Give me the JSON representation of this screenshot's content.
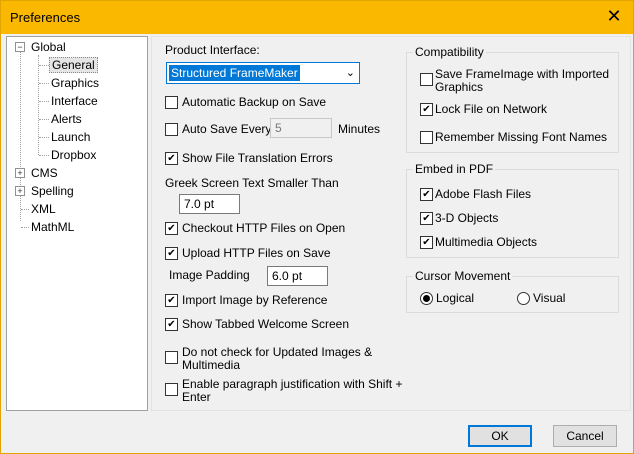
{
  "window": {
    "title": "Preferences",
    "close_glyph": "✕"
  },
  "tree": {
    "items": [
      {
        "label": "Global",
        "expander": "−"
      },
      {
        "label": "General"
      },
      {
        "label": "Graphics"
      },
      {
        "label": "Interface"
      },
      {
        "label": "Alerts"
      },
      {
        "label": "Launch"
      },
      {
        "label": "Dropbox"
      },
      {
        "label": "CMS",
        "expander": "+"
      },
      {
        "label": "Spelling",
        "expander": "+"
      },
      {
        "label": "XML"
      },
      {
        "label": "MathML"
      }
    ]
  },
  "general": {
    "product_interface_label": "Product Interface:",
    "product_interface_value": "Structured FrameMaker",
    "auto_backup": {
      "label": "Automatic Backup on Save",
      "checked": false
    },
    "auto_save": {
      "label": "Auto Save Every",
      "checked": false,
      "value": "5",
      "unit": "Minutes"
    },
    "show_translation_errors": {
      "label": "Show File Translation Errors",
      "checked": true
    },
    "greek_label": "Greek Screen Text Smaller Than",
    "greek_value": "7.0 pt",
    "checkout_http": {
      "label": "Checkout HTTP Files on Open",
      "checked": true
    },
    "upload_http": {
      "label": "Upload HTTP Files on Save",
      "checked": true
    },
    "image_padding_label": "Image Padding",
    "image_padding_value": "6.0 pt",
    "import_by_reference": {
      "label": "Import Image by Reference",
      "checked": true
    },
    "tabbed_welcome": {
      "label": "Show Tabbed Welcome Screen",
      "checked": true
    },
    "no_check_updated": {
      "label_line1": "Do not check for Updated Images &",
      "label_line2": "Multimedia",
      "checked": false
    },
    "para_justification": {
      "label_line1": "Enable paragraph justification with Shift +",
      "label_line2": "Enter",
      "checked": false
    }
  },
  "compatibility": {
    "title": "Compatibility",
    "save_frameimage": {
      "label_line1": "Save FrameImage with Imported",
      "label_line2": "Graphics",
      "checked": false
    },
    "lock_file": {
      "label": "Lock File on Network",
      "checked": true
    },
    "remember_fonts": {
      "label": "Remember Missing Font Names",
      "checked": false
    }
  },
  "embed_pdf": {
    "title": "Embed in PDF",
    "flash": {
      "label": "Adobe Flash Files",
      "checked": true
    },
    "objects_3d": {
      "label": "3-D Objects",
      "checked": true
    },
    "multimedia": {
      "label": "Multimedia Objects",
      "checked": true
    }
  },
  "cursor": {
    "title": "Cursor Movement",
    "logical": {
      "label": "Logical",
      "selected": true
    },
    "visual": {
      "label": "Visual",
      "selected": false
    }
  },
  "buttons": {
    "ok": "OK",
    "cancel": "Cancel"
  }
}
